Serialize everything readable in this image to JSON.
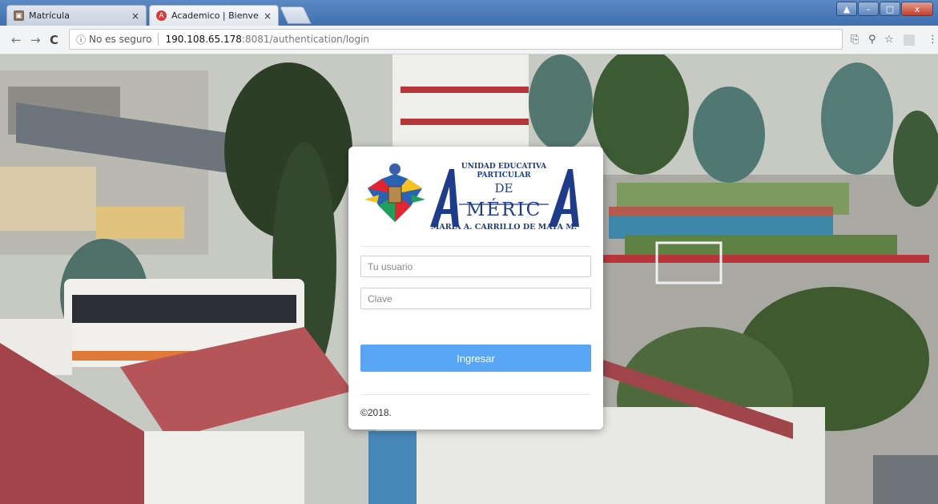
{
  "browser": {
    "tabs": [
      {
        "title": "Matrícula",
        "close": "×"
      },
      {
        "title": "Academico | Bienvenido",
        "close": "×"
      }
    ],
    "window_controls": {
      "minimize": "–",
      "maximize": "□",
      "close": "x"
    },
    "address": {
      "security_label": "No es seguro",
      "host": "190.108.65.178",
      "path": ":8081/authentication/login"
    }
  },
  "login": {
    "logo": {
      "line1": "UNIDAD EDUCATIVA",
      "line2": "PARTICULAR",
      "line3": "DE",
      "line4": "MÉRIC",
      "line5": "MARÍA A. CARRILLO DE MATA M."
    },
    "username_placeholder": "Tu usuario",
    "password_placeholder": "Clave",
    "submit_label": "Ingresar",
    "copyright": "©2018."
  },
  "colors": {
    "accent": "#58a6f5",
    "logo_blue": "#1f3c8c"
  }
}
